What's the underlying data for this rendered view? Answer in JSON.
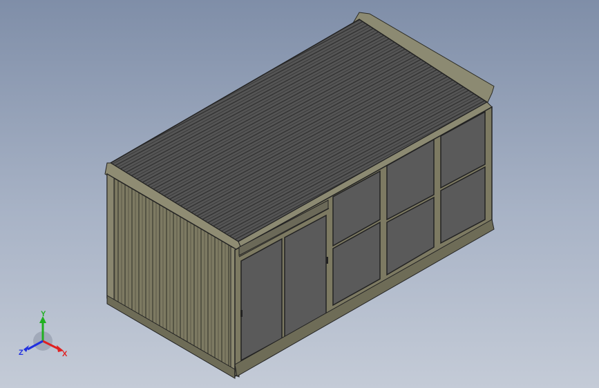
{
  "viewport": {
    "background_top": "#7f8ea8",
    "background_bottom": "#c4cbd7"
  },
  "model": {
    "object": "container-building",
    "roof_color": "#4a4a4a",
    "frame_color": "#7d7a62",
    "panel_color": "#5a5a5a"
  },
  "triad": {
    "x_label": "X",
    "y_label": "Y",
    "z_label": "Z",
    "x_color": "#e02020",
    "y_color": "#20b020",
    "z_color": "#2030e0"
  }
}
